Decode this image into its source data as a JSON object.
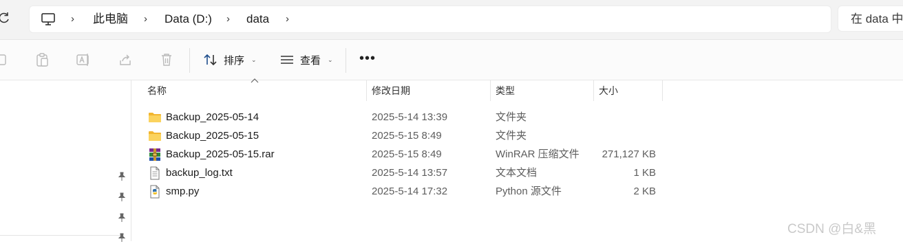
{
  "address_bar": {
    "breadcrumbs": [
      "此电脑",
      "Data (D:)",
      "data"
    ],
    "search_placeholder": "在 data 中"
  },
  "toolbar": {
    "sort_label": "排序",
    "view_label": "查看",
    "more_label": "•••"
  },
  "columns": {
    "name": "名称",
    "date_modified": "修改日期",
    "type": "类型",
    "size": "大小"
  },
  "files": [
    {
      "name": "Backup_2025-05-14",
      "date": "2025-5-14 13:39",
      "type": "文件夹",
      "size": "",
      "icon": "folder-icon"
    },
    {
      "name": "Backup_2025-05-15",
      "date": "2025-5-15 8:49",
      "type": "文件夹",
      "size": "",
      "icon": "folder-icon"
    },
    {
      "name": "Backup_2025-05-15.rar",
      "date": "2025-5-15 8:49",
      "type": "WinRAR 压缩文件",
      "size": "271,127 KB",
      "icon": "winrar-icon"
    },
    {
      "name": "backup_log.txt",
      "date": "2025-5-14 13:57",
      "type": "文本文档",
      "size": "1 KB",
      "icon": "text-file-icon"
    },
    {
      "name": "smp.py",
      "date": "2025-5-14 17:32",
      "type": "Python 源文件",
      "size": "2 KB",
      "icon": "python-file-icon"
    }
  ],
  "watermark": "CSDN @白&黑",
  "colors": {
    "folder": "#f7c948",
    "accent": "#0067c0"
  }
}
